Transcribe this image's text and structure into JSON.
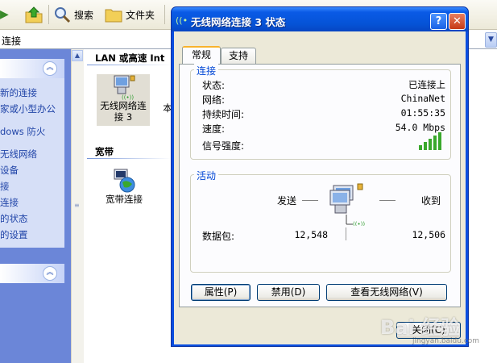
{
  "explorer": {
    "toolbar": {
      "search_label": "搜索",
      "folders_label": "文件夹"
    },
    "address_text": "连接",
    "taskpane": {
      "links": [
        "新的连接",
        "家或小型办公",
        "dows 防火",
        "无线网络",
        "设备",
        "接",
        "连接",
        "的状态",
        "的设置"
      ]
    },
    "groups": {
      "lan_title": "LAN 或高速 Int",
      "broadband_title": "宽带"
    },
    "items": {
      "wireless_label": "无线网络连接 3",
      "second_label": "本",
      "broadband_label": "宽带连接"
    }
  },
  "dialog": {
    "title": "无线网络连接 3 状态",
    "help_label": "?",
    "close_label": "✕",
    "tabs": [
      {
        "label": "常规",
        "active": true
      },
      {
        "label": "支持",
        "active": false
      }
    ],
    "connection": {
      "group_label": "连接",
      "rows": [
        {
          "label": "状态:",
          "value": "已连接上"
        },
        {
          "label": "网络:",
          "value": "ChinaNet"
        },
        {
          "label": "持续时间:",
          "value": "01:55:35"
        },
        {
          "label": "速度:",
          "value": "54.0 Mbps"
        }
      ],
      "signal_label": "信号强度:",
      "signal_bars": 5
    },
    "activity": {
      "group_label": "活动",
      "sent_label": "发送",
      "received_label": "收到",
      "packets_label": "数据包:",
      "packets_sent": "12,548",
      "packets_received": "12,506"
    },
    "buttons": {
      "properties": "属性(P)",
      "disable": "禁用(D)",
      "view_wireless": "查看无线网络(V)",
      "close": "关闭(C)"
    }
  },
  "watermark": {
    "text": "Bai 经验",
    "sub": "jingyan.baidu.com"
  },
  "colors": {
    "title_blue": "#0553d6",
    "group_label": "#0046d5",
    "signal_green": "#3aa82c"
  }
}
